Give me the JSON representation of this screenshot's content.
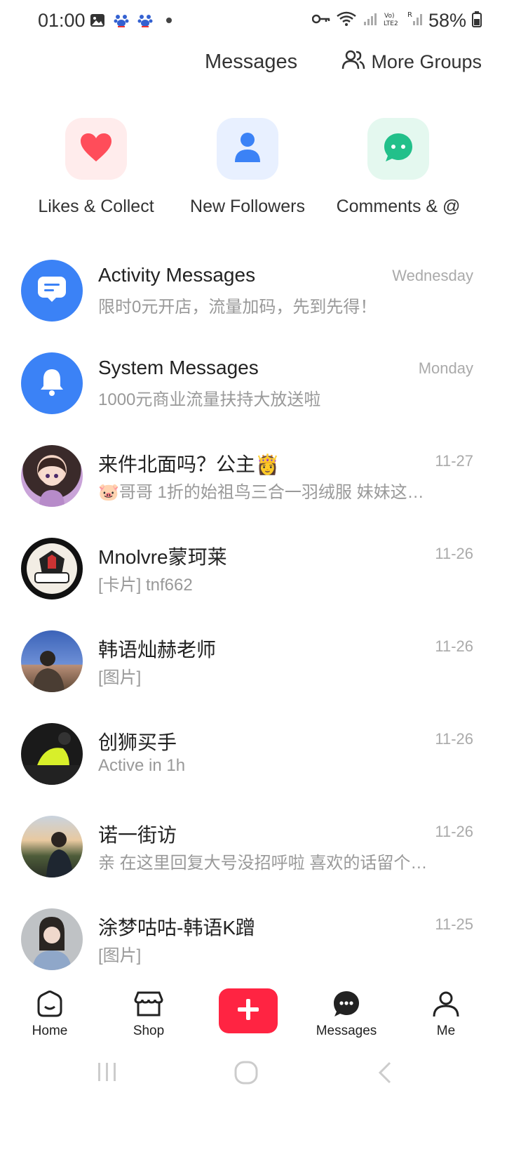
{
  "status_bar": {
    "time": "01:00",
    "battery": "58%"
  },
  "header": {
    "title": "Messages",
    "more_groups": "More Groups"
  },
  "categories": [
    {
      "label": "Likes & Collect",
      "icon": "heart-icon",
      "color": "#ff4d5a",
      "bg": "#ffecec"
    },
    {
      "label": "New Followers",
      "icon": "person-icon",
      "color": "#3b82f6",
      "bg": "#e8f0ff"
    },
    {
      "label": "Comments & @",
      "icon": "chat-bubble-icon",
      "color": "#22c08a",
      "bg": "#e4f8ef"
    }
  ],
  "messages": [
    {
      "title": "Activity Messages",
      "subtitle": "限时0元开店，流量加码，先到先得！",
      "time": "Wednesday",
      "avatar": "activity-icon"
    },
    {
      "title": "System Messages",
      "subtitle": "1000元商业流量扶持大放送啦",
      "time": "Monday",
      "avatar": "bell-icon"
    },
    {
      "title": "来件北面吗？公主👸",
      "subtitle": "🐷哥哥 1折的始祖鸟三合一羽绒服 妹妹这…",
      "time": "11-27",
      "avatar": "user-avatar"
    },
    {
      "title": "Mnolvre蒙珂莱",
      "subtitle": "[卡片] tnf662",
      "time": "11-26",
      "avatar": "user-avatar"
    },
    {
      "title": "韩语灿赫老师",
      "subtitle": "[图片]",
      "time": "11-26",
      "avatar": "user-avatar"
    },
    {
      "title": "创狮买手",
      "subtitle": "Active in 1h",
      "time": "11-26",
      "avatar": "user-avatar"
    },
    {
      "title": "诺一街访",
      "subtitle": "亲 在这里回复大号没招呼啦 喜欢的话留个…",
      "time": "11-26",
      "avatar": "user-avatar"
    },
    {
      "title": "涂梦咕咕-韩语K蹭",
      "subtitle": "[图片]",
      "time": "11-25",
      "avatar": "user-avatar"
    }
  ],
  "bottom_nav": {
    "home": "Home",
    "shop": "Shop",
    "messages": "Messages",
    "me": "Me",
    "post_color": "#ff2442"
  }
}
